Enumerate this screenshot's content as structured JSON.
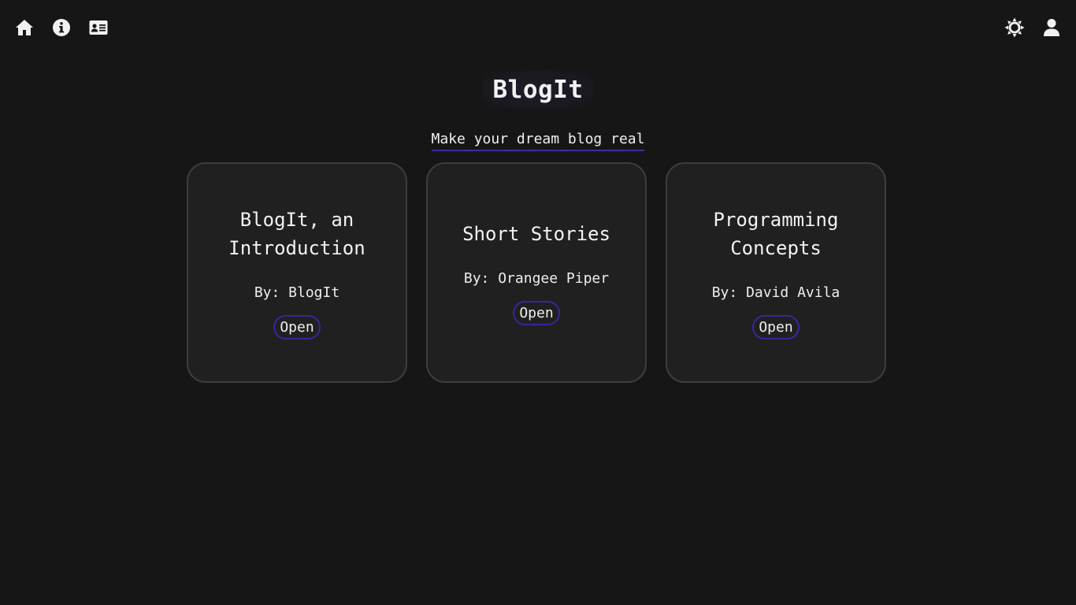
{
  "nav": {
    "left_icons": [
      "home-icon",
      "info-icon",
      "contact-card-icon"
    ],
    "right_icons": [
      "theme-toggle-icon",
      "user-icon"
    ]
  },
  "brand": {
    "title": "BlogIt",
    "tagline": "Make your dream blog real"
  },
  "cards": [
    {
      "title": "BlogIt, an Introduction",
      "author": "By: BlogIt",
      "button": "Open"
    },
    {
      "title": "Short Stories",
      "author": "By: Orangee Piper",
      "button": "Open"
    },
    {
      "title": "Programming Concepts",
      "author": "By: David Avila",
      "button": "Open"
    }
  ],
  "colors": {
    "background": "#161616",
    "card": "#202020",
    "accent": "#33299a",
    "text": "#f0f0f0"
  }
}
